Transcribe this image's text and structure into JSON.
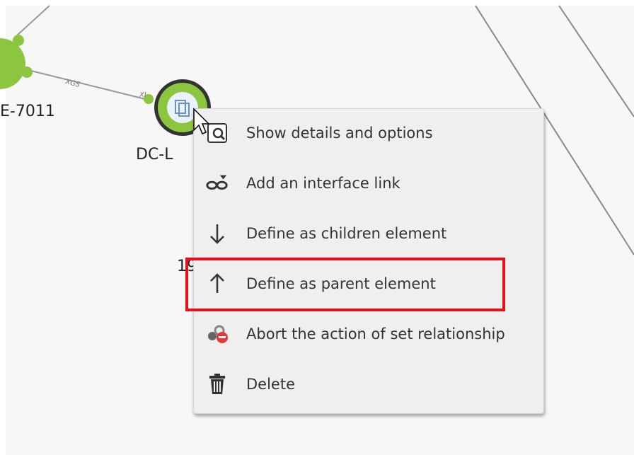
{
  "canvas": {
    "nodes": [
      {
        "label": "E-7011"
      },
      {
        "label": "DC-L"
      }
    ],
    "link_labels": [
      "XGS",
      "XI"
    ],
    "partial_text": "19"
  },
  "context_menu": {
    "items": [
      {
        "label": "Show details and options",
        "icon": "search-details-icon"
      },
      {
        "label": "Add an interface link",
        "icon": "interface-link-icon"
      },
      {
        "label": "Define as children element",
        "icon": "arrow-down-icon"
      },
      {
        "label": "Define as parent element",
        "icon": "arrow-up-icon"
      },
      {
        "label": "Abort the action of set relationship",
        "icon": "abort-relationship-icon"
      },
      {
        "label": "Delete",
        "icon": "trash-icon"
      }
    ],
    "highlighted_item": "Define as parent element"
  },
  "colors": {
    "node_green": "#8cc63f",
    "node_border": "#333333",
    "highlight": "#e8101a",
    "menu_bg": "#efefef"
  }
}
